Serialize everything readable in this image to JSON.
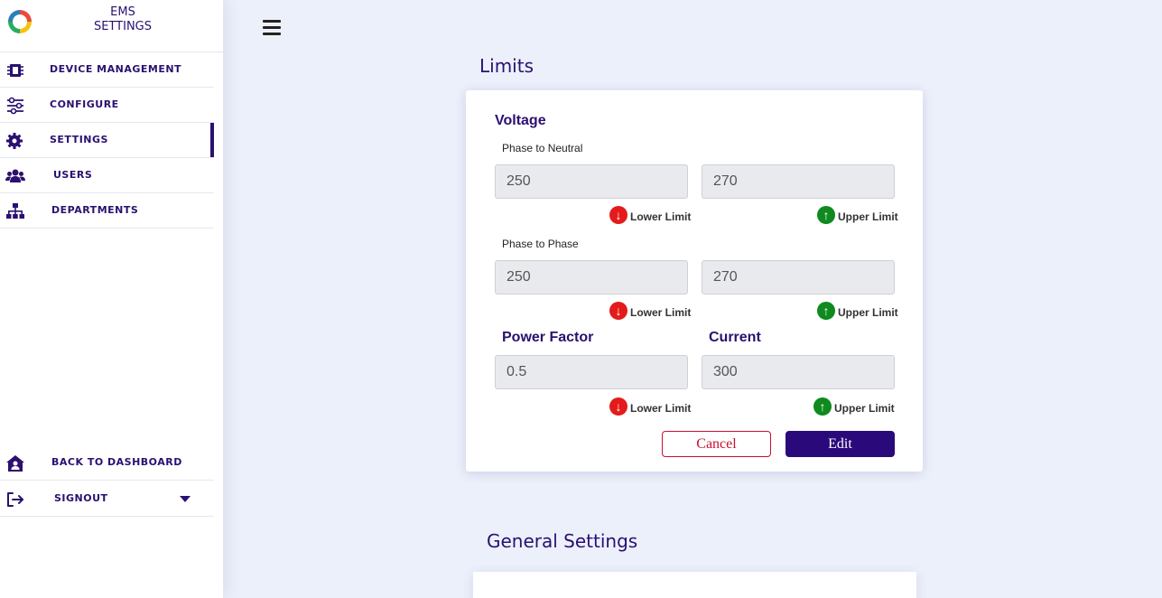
{
  "brand": {
    "line1": "EMS",
    "line2": "SETTINGS"
  },
  "sidebar": {
    "items": [
      {
        "label": "DEVICE MANAGEMENT",
        "icon": "chip-icon"
      },
      {
        "label": "CONFIGURE",
        "icon": "sliders-icon"
      },
      {
        "label": "SETTINGS",
        "icon": "gear-icon"
      },
      {
        "label": "USERS",
        "icon": "users-icon"
      },
      {
        "label": "DEPARTMENTS",
        "icon": "sitemap-icon"
      }
    ],
    "back_label": "BACK TO DASHBOARD",
    "signout_label": "SIGNOUT"
  },
  "limits": {
    "title": "Limits",
    "voltage": {
      "heading": "Voltage",
      "phase_neutral": {
        "label": "Phase to Neutral",
        "lower": "250",
        "upper": "270"
      },
      "phase_phase": {
        "label": "Phase to Phase",
        "lower": "250",
        "upper": "270"
      }
    },
    "power_factor": {
      "heading": "Power Factor",
      "value": "0.5"
    },
    "current": {
      "heading": "Current",
      "value": "300"
    },
    "lower_label": "Lower Limit",
    "upper_label": "Upper Limit",
    "cancel_label": "Cancel",
    "edit_label": "Edit"
  },
  "general": {
    "title": "General Settings"
  },
  "colors": {
    "accent": "#2a1070",
    "down": "#e31b1b",
    "up": "#0e8a1e",
    "cancel": "#c8102e"
  }
}
